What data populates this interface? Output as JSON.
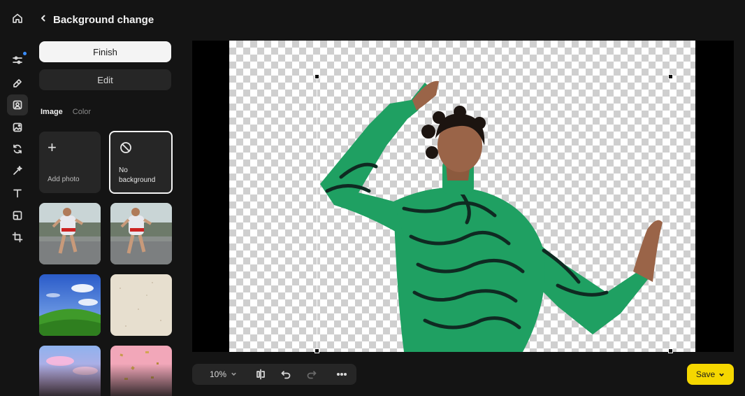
{
  "header": {
    "title": "Background change"
  },
  "panel": {
    "finish_label": "Finish",
    "edit_label": "Edit",
    "tabs": [
      {
        "label": "Image",
        "active": true
      },
      {
        "label": "Color",
        "active": false
      }
    ],
    "add_photo_label": "Add photo",
    "no_background_label": "No\nbackground"
  },
  "rail": {
    "icons": [
      "home-icon",
      "adjust-icon",
      "eraser-icon",
      "portrait-icon",
      "image-edit-icon",
      "rotate-icon",
      "magic-icon",
      "text-icon",
      "layout-icon",
      "crop-icon"
    ],
    "active": "portrait-icon"
  },
  "toolbar": {
    "zoom_value": "10%"
  },
  "actions": {
    "save_label": "Save"
  },
  "colors": {
    "accent": "#f5d700",
    "panel": "#262626",
    "background": "#141414",
    "notification": "#3a8dff"
  }
}
